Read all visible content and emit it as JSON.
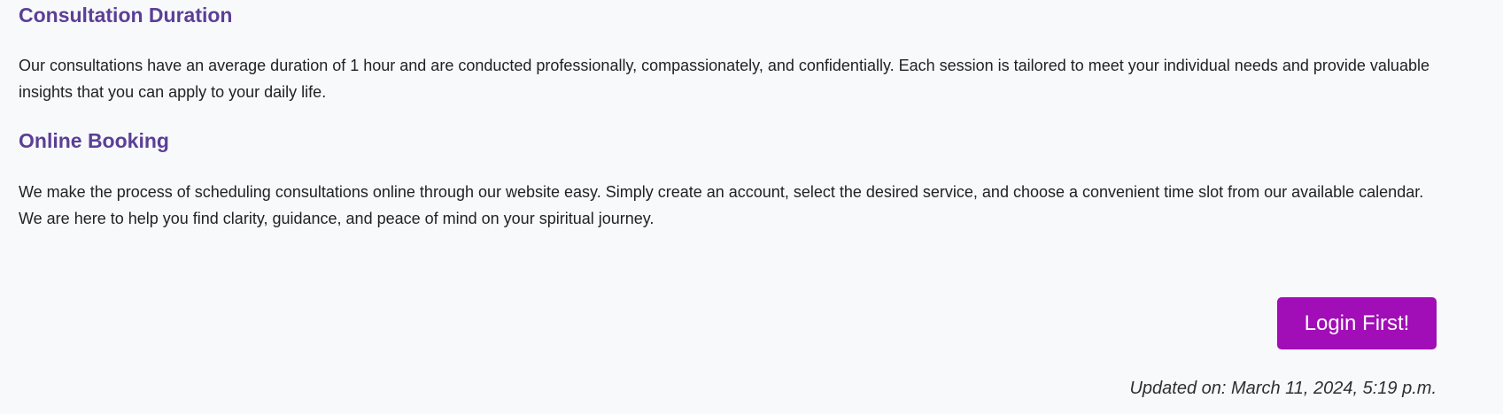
{
  "sections": [
    {
      "heading": "Consultation Duration",
      "body": "Our consultations have an average duration of 1 hour and are conducted professionally, compassionately, and confidentially. Each session is tailored to meet your individual needs and provide valuable insights that you can apply to your daily life."
    },
    {
      "heading": "Online Booking",
      "body": "We make the process of scheduling consultations online through our website easy. Simply create an account, select the desired service, and choose a convenient time slot from our available calendar. We are here to help you find clarity, guidance, and peace of mind on your spiritual journey."
    }
  ],
  "actions": {
    "login_label": "Login First!"
  },
  "footer": {
    "updated": "Updated on: March 11, 2024, 5:19 p.m."
  },
  "colors": {
    "heading": "#5b3f96",
    "button": "#a10db6",
    "background": "#f8f9fb"
  }
}
